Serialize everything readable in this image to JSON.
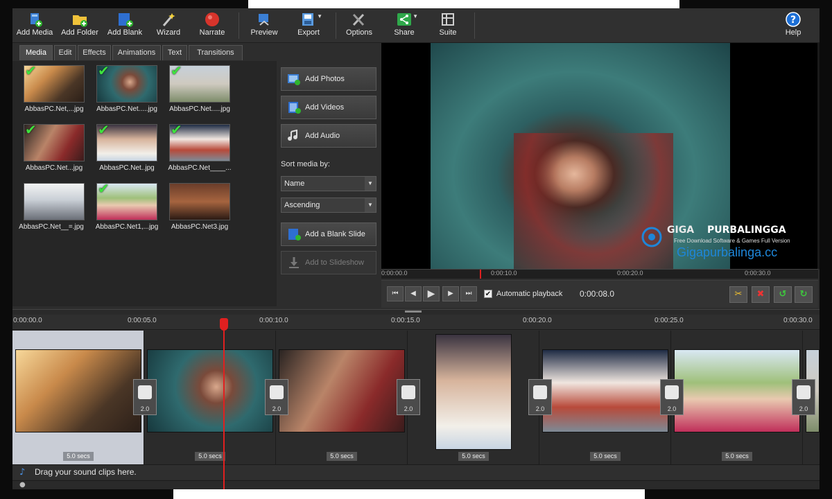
{
  "toolbar": {
    "add_media": "Add Media",
    "add_folder": "Add Folder",
    "add_blank": "Add Blank",
    "wizard": "Wizard",
    "narrate": "Narrate",
    "preview": "Preview",
    "export": "Export",
    "options": "Options",
    "share": "Share",
    "suite": "Suite",
    "help": "Help"
  },
  "tabs": [
    "Media",
    "Edit",
    "Effects",
    "Animations",
    "Text",
    "Transitions"
  ],
  "media": [
    {
      "caption": "AbbasPC.Net,...jpg",
      "icon": "photo-thumbnail",
      "checked": true
    },
    {
      "caption": "AbbasPC.Net.....jpg",
      "icon": "photo-thumbnail",
      "checked": true
    },
    {
      "caption": "AbbasPC.Net.....jpg",
      "icon": "photo-thumbnail",
      "checked": true
    },
    {
      "caption": "AbbasPC.Net...jpg",
      "icon": "photo-thumbnail",
      "checked": true
    },
    {
      "caption": "AbbasPC.Net..jpg",
      "icon": "photo-thumbnail",
      "checked": true
    },
    {
      "caption": "AbbasPC.Net____...",
      "icon": "photo-thumbnail",
      "checked": true
    },
    {
      "caption": "AbbasPC.Net__=.jpg",
      "icon": "photo-thumbnail",
      "checked": false
    },
    {
      "caption": "AbbasPC.Net1,...jpg",
      "icon": "photo-thumbnail",
      "checked": true
    },
    {
      "caption": "AbbasPC.Net3.jpg",
      "icon": "photo-thumbnail",
      "checked": false
    }
  ],
  "side": {
    "add_photos": "Add Photos",
    "add_videos": "Add Videos",
    "add_audio": "Add Audio",
    "sort_label": "Sort media by:",
    "sort_by": "Name",
    "sort_order": "Ascending",
    "add_blank_slide": "Add a Blank Slide",
    "add_to_slideshow": "Add to Slideshow"
  },
  "preview": {
    "ruler": [
      "0:00:00.0",
      "0:00:10.0",
      "0:00:20.0",
      "0:00:30.0"
    ],
    "automatic_playback": "Automatic playback",
    "automatic_playback_checked": true,
    "current_time": "0:00:08.0",
    "watermark": {
      "brand_left": "GIGA",
      "brand_right": "PURBALINGGA",
      "tagline": "Free Download Software & Games Full Version",
      "url": "Gigapurbalinga.cc"
    }
  },
  "timeline": {
    "ruler": [
      "0:00:00.0",
      "0:00:05.0",
      "0:00:10.0",
      "0:00:15.0",
      "0:00:20.0",
      "0:00:25.0",
      "0:00:30.0"
    ],
    "clips": [
      {
        "duration": "5.0 secs",
        "transition": "2.0"
      },
      {
        "duration": "5.0 secs",
        "transition": "2.0"
      },
      {
        "duration": "5.0 secs",
        "transition": "2.0"
      },
      {
        "duration": "5.0 secs",
        "transition": ""
      },
      {
        "duration": "5.0 secs",
        "transition": "2.0"
      },
      {
        "duration": "5.0 secs",
        "transition": "2.0"
      }
    ],
    "audio_hint": "Drag your sound clips here."
  },
  "colors": {
    "accent_red": "#e02020",
    "check_green": "#3ee23e",
    "watermark_blue": "#1e86d9",
    "selected_slot": "#c9cdd6"
  }
}
